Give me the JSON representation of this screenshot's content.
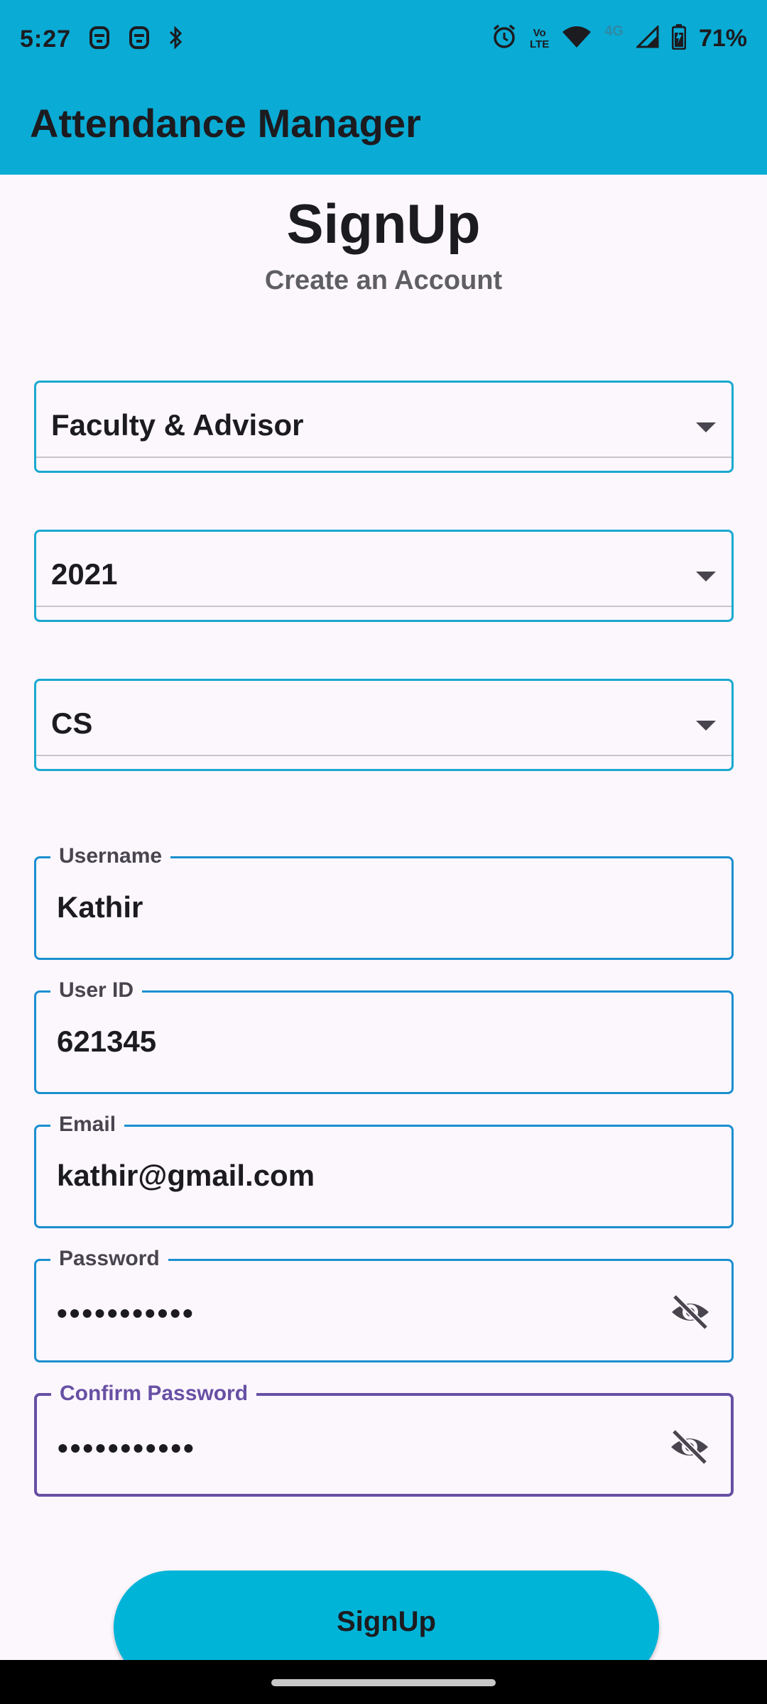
{
  "status_bar": {
    "time": "5:27",
    "left_icons": [
      "notification-icon",
      "notification-icon",
      "bluetooth-icon"
    ],
    "lte_label_top": "Vo",
    "lte_label_bottom": "LTE",
    "network_label": "4G",
    "battery_percent": "71%"
  },
  "app_bar": {
    "title": "Attendance Manager"
  },
  "header": {
    "title": "SignUp",
    "subtitle": "Create an Account"
  },
  "dropdowns": {
    "role": "Faculty & Advisor",
    "year": "2021",
    "department": "CS"
  },
  "fields": {
    "username": {
      "label": "Username",
      "value": "Kathir"
    },
    "user_id": {
      "label": "User ID",
      "value": "621345"
    },
    "email": {
      "label": "Email",
      "value": "kathir@gmail.com"
    },
    "password": {
      "label": "Password",
      "value": "•••••••••••"
    },
    "confirm_password": {
      "label": "Confirm Password",
      "value": "•••••••••••"
    }
  },
  "icons": {
    "password_toggle": "eye-off-icon",
    "confirm_password_toggle": "eye-off-icon"
  },
  "actions": {
    "signup_label": "SignUp"
  },
  "colors": {
    "app_bar": "#0aabd4",
    "button": "#00b4d8",
    "field_border": "#1b8fcf",
    "focused_border": "#6750a4"
  }
}
